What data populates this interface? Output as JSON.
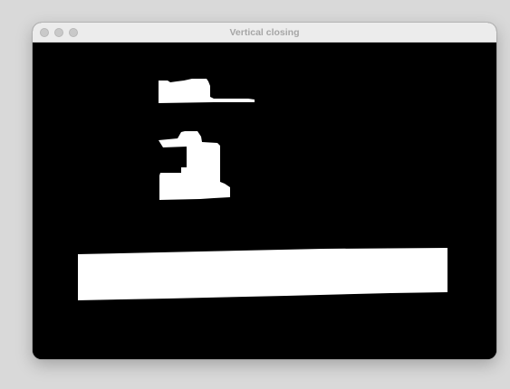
{
  "window": {
    "title": "Vertical closing",
    "controls": [
      "close",
      "minimize",
      "zoom"
    ]
  },
  "image": {
    "description": "binary morphological result image (white blobs on black background)",
    "background_color": "#000000",
    "foreground_color": "#ffffff"
  }
}
